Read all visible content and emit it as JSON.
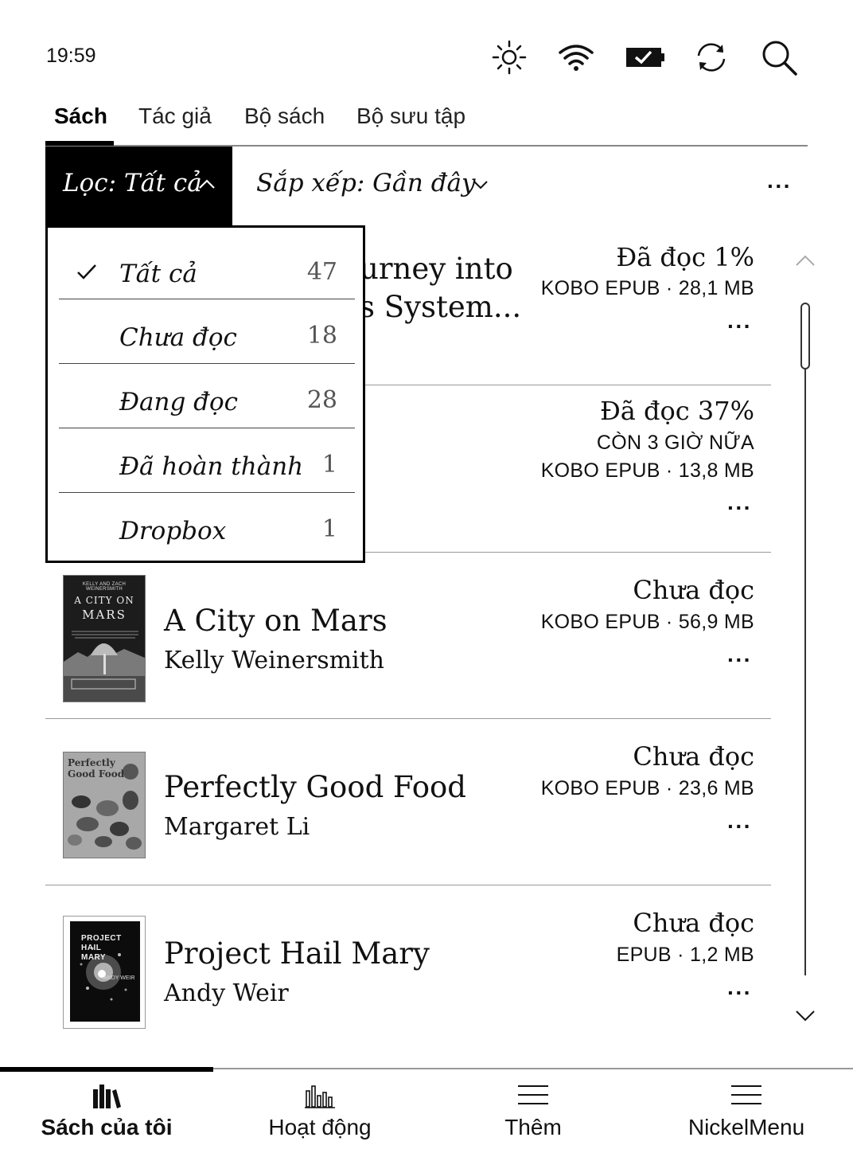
{
  "status_bar": {
    "time": "19:59"
  },
  "tabs": [
    {
      "label": "Sách",
      "active": true
    },
    {
      "label": "Tác giả"
    },
    {
      "label": "Bộ sách"
    },
    {
      "label": "Bộ sưu tập"
    }
  ],
  "filter_bar": {
    "filter_label": "Lọc: Tất cả",
    "sort_label": "Sắp xếp: Gần đây",
    "more_label": "···"
  },
  "books": [
    {
      "title_fragment_1": "urney into",
      "title_fragment_2": "s System...",
      "status": "Đã đọc 1%",
      "meta": "KOBO EPUB · 28,1 MB",
      "more": "···"
    },
    {
      "status": "Đã đọc 37%",
      "time_left": "CÒN 3 GIỜ NỮA",
      "meta": "KOBO EPUB · 13,8 MB",
      "more": "···"
    },
    {
      "title": "A City on Mars",
      "author": "Kelly Weinersmith",
      "status": "Chưa đọc",
      "meta": "KOBO EPUB · 56,9 MB",
      "more": "···",
      "cover": {
        "top": "KELLY AND ZACH WEINERSMITH",
        "line1": "A CITY ON",
        "line2": "MARS"
      }
    },
    {
      "title": "Perfectly Good Food",
      "author": "Margaret Li",
      "status": "Chưa đọc",
      "meta": "KOBO EPUB · 23,6 MB",
      "more": "···",
      "cover": {
        "line1": "Perfectly",
        "line2": "Good Food"
      }
    },
    {
      "title": "Project Hail Mary",
      "author": "Andy Weir",
      "status": "Chưa đọc",
      "meta": "EPUB · 1,2 MB",
      "more": "···",
      "cover": {
        "line1": "PROJECT",
        "line2": "HAIL",
        "line3": "MARY",
        "author": "ANDY WEIR"
      }
    }
  ],
  "filter_dropdown": {
    "items": [
      {
        "label": "Tất cả",
        "count": "47",
        "selected": true
      },
      {
        "label": "Chưa đọc",
        "count": "18"
      },
      {
        "label": "Đang đọc",
        "count": "28"
      },
      {
        "label": "Đã hoàn thành",
        "count": "1"
      },
      {
        "label": "Dropbox",
        "count": "1"
      }
    ]
  },
  "bottom_nav": [
    {
      "label": "Sách của tôi",
      "icon": "books-icon",
      "active": true
    },
    {
      "label": "Hoạt động",
      "icon": "activity-chart-icon"
    },
    {
      "label": "Thêm",
      "icon": "menu-icon"
    },
    {
      "label": "NickelMenu",
      "icon": "menu-icon"
    }
  ]
}
